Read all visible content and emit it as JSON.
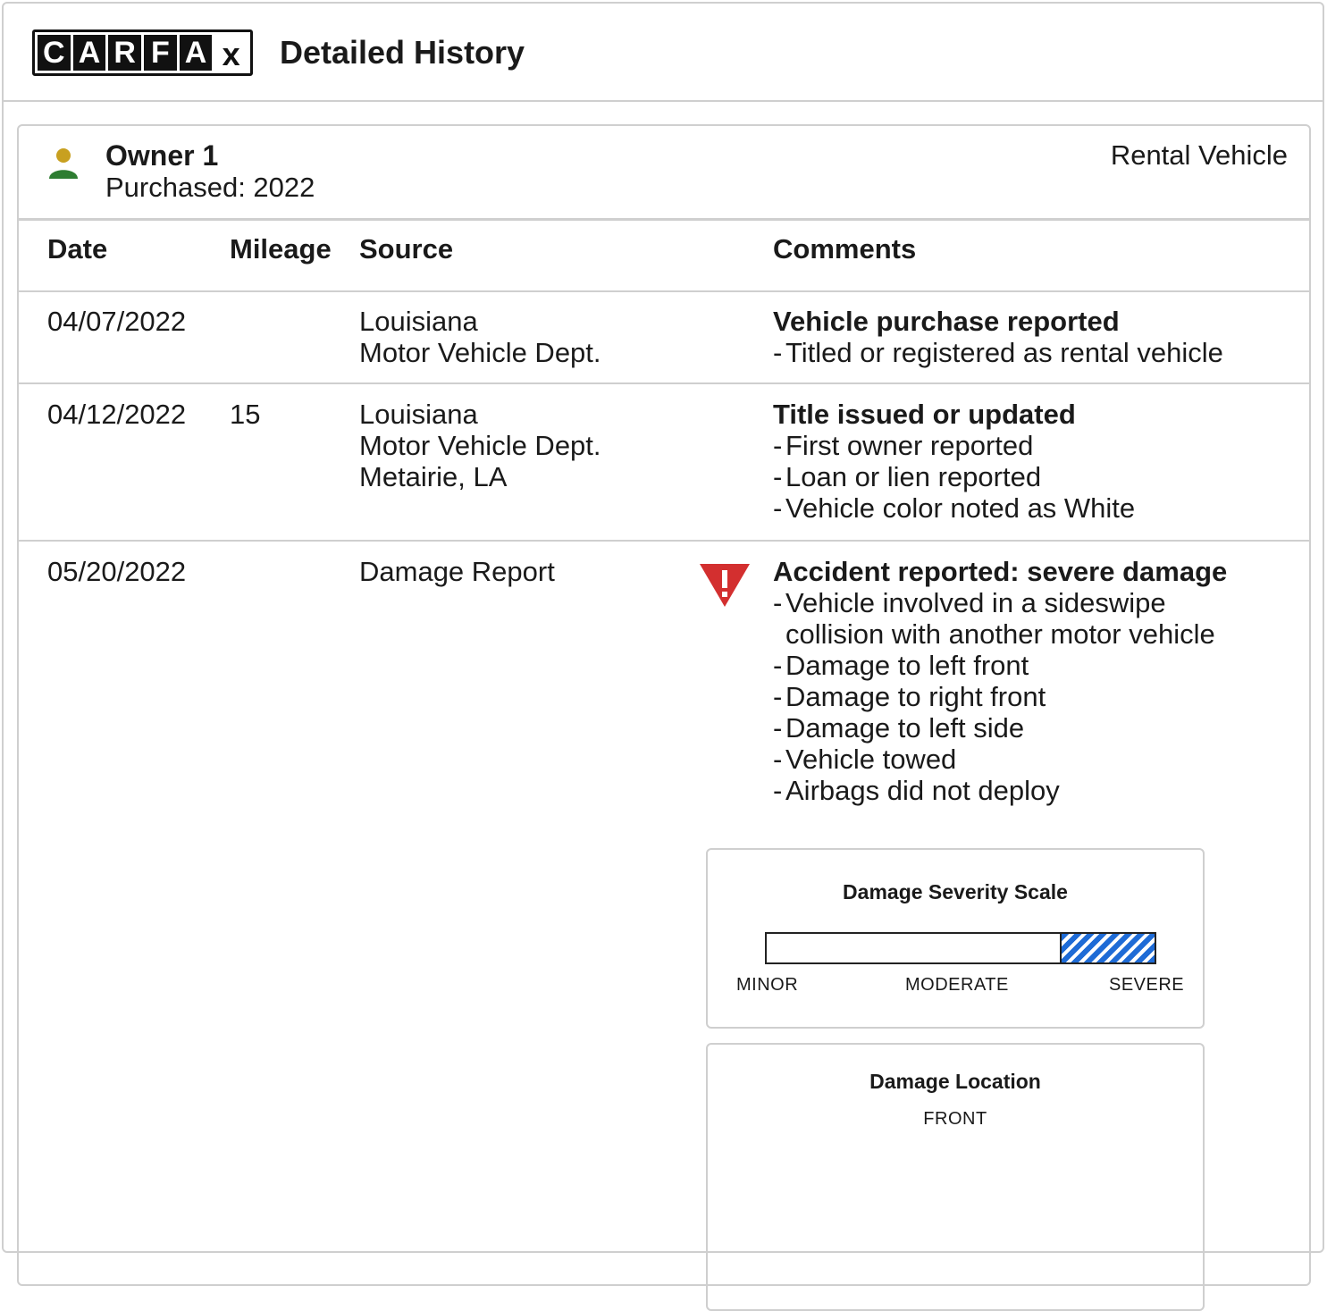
{
  "header": {
    "logo_letters": [
      "C",
      "A",
      "R",
      "F",
      "A",
      "x"
    ],
    "title": "Detailed History"
  },
  "owner": {
    "name": "Owner 1",
    "purchased": "Purchased: 2022",
    "type": "Rental Vehicle"
  },
  "table": {
    "columns": [
      "Date",
      "Mileage",
      "Source",
      "Comments"
    ],
    "rows": [
      {
        "date": "04/07/2022",
        "mileage": "",
        "source": [
          "Louisiana",
          "Motor Vehicle Dept."
        ],
        "comment_title": "Vehicle purchase reported",
        "comment_items": [
          "Titled or registered as rental vehicle"
        ]
      },
      {
        "date": "04/12/2022",
        "mileage": "15",
        "source": [
          "Louisiana",
          "Motor Vehicle Dept.",
          "Metairie, LA"
        ],
        "comment_title": "Title issued or updated",
        "comment_items": [
          "First owner reported",
          "Loan or lien reported",
          "Vehicle color noted as White"
        ]
      },
      {
        "date": "05/20/2022",
        "mileage": "",
        "source": [
          "Damage Report"
        ],
        "comment_title": "Accident reported: severe damage",
        "comment_items": [
          [
            "Vehicle involved in a sideswipe",
            "collision with another motor vehicle"
          ],
          "Damage to left front",
          "Damage to right front",
          "Damage to left side",
          "Vehicle towed",
          "Airbags did not deploy"
        ]
      }
    ]
  },
  "severity_scale": {
    "title": "Damage Severity Scale",
    "labels": [
      "MINOR",
      "MODERATE",
      "SEVERE"
    ],
    "level_fraction": 0.24,
    "fill_color": "#1e6bd6"
  },
  "damage_location": {
    "title": "Damage Location",
    "subtitle": "FRONT"
  },
  "colors": {
    "person_head": "#c8a020",
    "person_body": "#2e7d32",
    "warning": "#d32f2f"
  }
}
